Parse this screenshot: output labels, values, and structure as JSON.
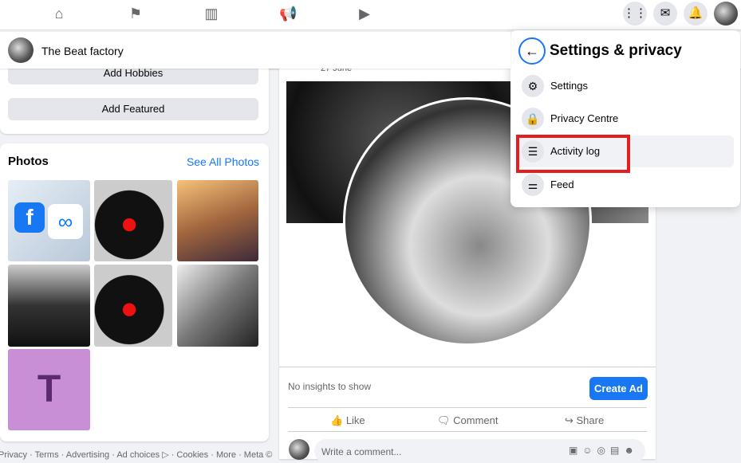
{
  "nav": {
    "icons": [
      "home-icon",
      "flag-icon",
      "chart-icon",
      "megaphone-icon",
      "video-icon"
    ],
    "right": [
      "menu-grid-icon",
      "messenger-icon",
      "notifications-icon",
      "profile-avatar"
    ]
  },
  "page": {
    "name": "The Beat factory"
  },
  "about": {
    "add_hobbies": "Add Hobbies",
    "add_featured": "Add Featured"
  },
  "photos": {
    "title": "Photos",
    "see_all": "See All Photos",
    "thumb_letter": "T"
  },
  "footer": "Privacy · Terms · Advertising · Ad choices ▷ · Cookies · More · Meta ©",
  "post": {
    "date": "27 June",
    "insights": "No insights to show",
    "create_ad": "Create Ad",
    "like": "Like",
    "comment": "Comment",
    "share": "Share",
    "comment_placeholder": "Write a comment..."
  },
  "menu": {
    "title": "Settings & privacy",
    "items": [
      {
        "label": "Settings",
        "icon": "gear-icon"
      },
      {
        "label": "Privacy Centre",
        "icon": "lock-icon"
      },
      {
        "label": "Activity log",
        "icon": "list-icon",
        "highlighted": true
      },
      {
        "label": "Feed",
        "icon": "sliders-icon"
      }
    ]
  },
  "colors": {
    "accent": "#1877f2",
    "highlight": "#e41e1e"
  }
}
